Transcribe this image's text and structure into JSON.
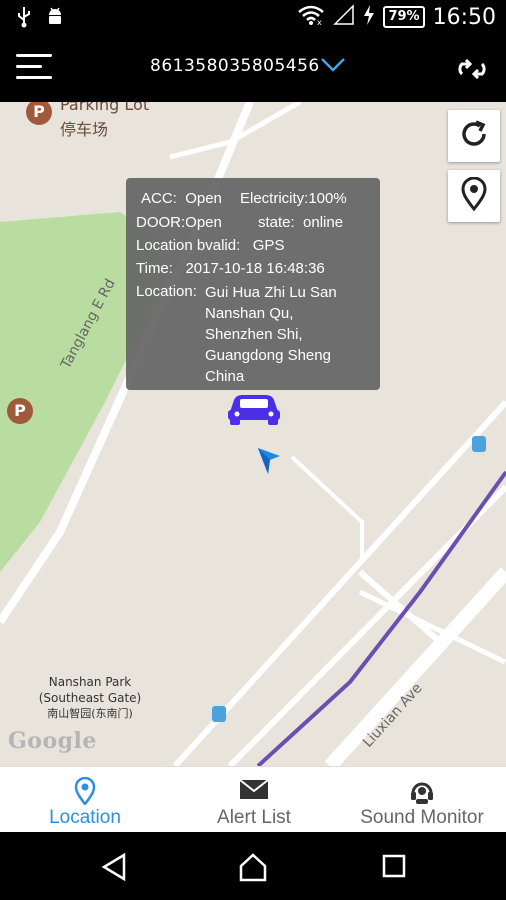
{
  "status_bar": {
    "battery": "79%",
    "time": "16:50"
  },
  "app_bar": {
    "device_id": "861358035805456"
  },
  "map": {
    "pois": {
      "parking_lot_en": "Parking Lot",
      "parking_lot_cn": "停车场",
      "parking_symbol": "P"
    },
    "roads": {
      "tanglang": "Tanglang E Rd",
      "liuxian": "Liuxian Ave"
    },
    "park": {
      "line1": "Nanshan Park",
      "line2": "(Southeast Gate)",
      "line3": "南山智园(东南门)"
    },
    "google": "Google"
  },
  "info": {
    "acc_label": "ACC:",
    "acc_value": "Open",
    "electricity_label": "Electricity:",
    "electricity_value": "100%",
    "door_label": "DOOR:",
    "door_value": "Open",
    "state_label": "state:",
    "state_value": "online",
    "location_valid_label": "Location bvalid:",
    "location_valid_value": "GPS",
    "time_label": "Time:",
    "time_value": "2017-10-18 16:48:36",
    "location_label": "Location:",
    "location_value": "Gui Hua Zhi Lu San\nNanshan Qu,\nShenzhen Shi,\nGuangdong Sheng\nChina"
  },
  "tabs": [
    {
      "label": "Location",
      "icon": "location-pin-icon",
      "active": true
    },
    {
      "label": "Alert List",
      "icon": "envelope-icon",
      "active": false
    },
    {
      "label": "Sound Monitor",
      "icon": "headset-icon",
      "active": false
    }
  ],
  "colors": {
    "accent": "#2d8fe0",
    "car": "#4b2fe6",
    "purple_line": "#6a4fb0",
    "park_green": "#b9dca0"
  }
}
